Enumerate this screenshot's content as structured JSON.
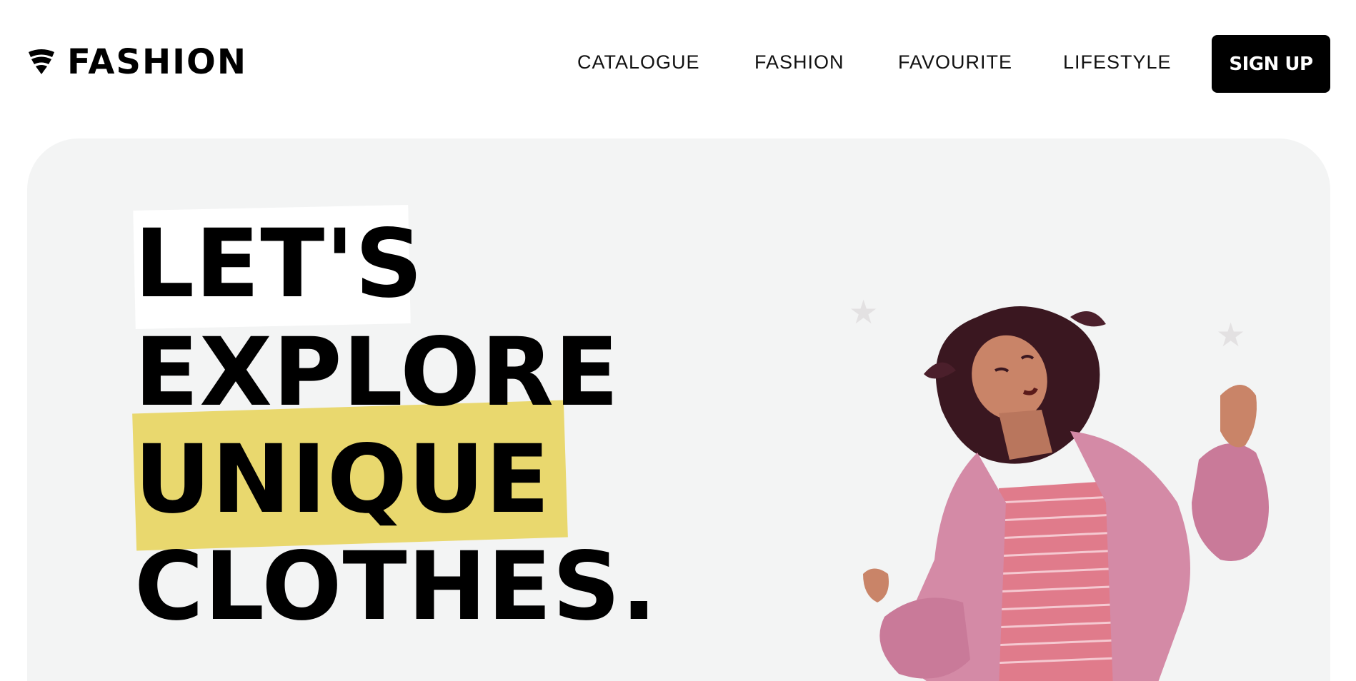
{
  "header": {
    "logo_text": "FASHION",
    "nav": [
      {
        "label": "CATALOGUE"
      },
      {
        "label": "FASHION"
      },
      {
        "label": "FAVOURITE"
      },
      {
        "label": "LIFESTYLE"
      }
    ],
    "signup_label": "SIGN UP"
  },
  "hero": {
    "headline": [
      "LET'S",
      "EXPLORE",
      "UNIQUE",
      "CLOTHES."
    ],
    "highlight_color": "#e9d86e",
    "background_color": "#f3f4f4"
  },
  "colors": {
    "brand": "#000000",
    "accent": "#e9d86e"
  },
  "icons": {
    "logo": "wifi-fan-logo-icon",
    "decor": "star-icon"
  }
}
